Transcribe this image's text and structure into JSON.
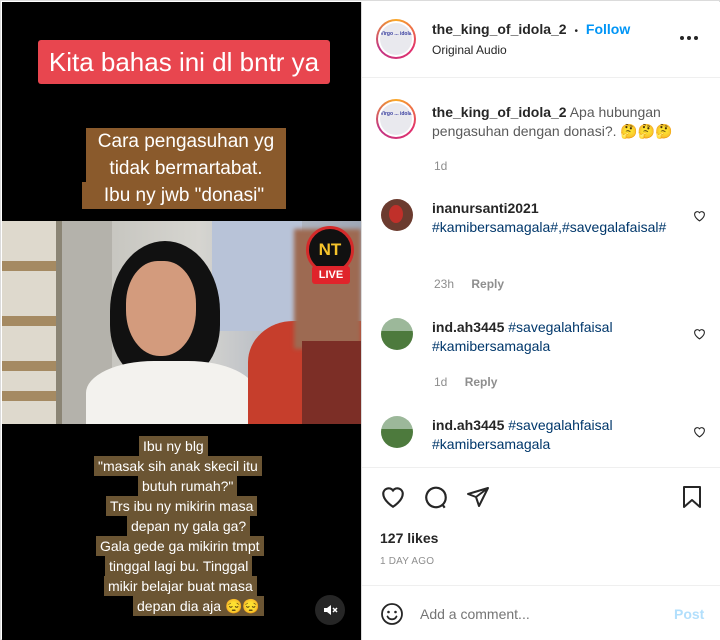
{
  "video": {
    "caption_top": "Kita bahas ini dl bntr ya",
    "caption_mid": [
      "Cara pengasuhan yg",
      "tidak bermartabat.",
      "Ibu ny jwb \"donasi\""
    ],
    "caption_bottom": [
      "Ibu ny blg",
      "\"masak sih anak skecil itu",
      "butuh rumah?\"",
      "Trs ibu ny mikirin masa",
      "depan ny gala ga?",
      "Gala gede ga mikirin tmpt",
      "tinggal lagi bu. Tinggal",
      "mikir belajar buat masa",
      "depan dia aja 😔😔"
    ],
    "live_logo": "NT",
    "live_label": "LIVE",
    "mute_icon": "speaker-muted-icon"
  },
  "post": {
    "username": "the_king_of_idola_2",
    "separator": "•",
    "follow_label": "Follow",
    "audio": "Original Audio",
    "avatar_text": "Virgo ... idola",
    "caption_text": "Apa hubungan pengasuhan dengan donasi?.",
    "caption_emoji": "🤔🤔🤔",
    "caption_time": "1d"
  },
  "comments": [
    {
      "username": "inanursanti2021",
      "text": "#kamibersamagala#,#savegalafaisal#",
      "time": "23h",
      "reply": "Reply",
      "avatar_color": "#6b3b2f"
    },
    {
      "username": "ind.ah3445",
      "text": "#savegalahfaisal #kamibersamagala",
      "time": "1d",
      "reply": "Reply",
      "avatar_color": "#5f8a4c"
    },
    {
      "username": "ind.ah3445",
      "text": "#savegalahfaisal #kamibersamagala",
      "time": "",
      "reply": "",
      "avatar_color": "#5f8a4c"
    }
  ],
  "actions": {
    "likes": "127 likes",
    "date": "1 DAY AGO"
  },
  "composer": {
    "placeholder": "Add a comment...",
    "post_label": "Post",
    "emoji_icon": "smiley-icon"
  },
  "colors": {
    "accent": "#0095f6",
    "post_disabled": "#b2dffc",
    "hashtag": "#00376b"
  }
}
